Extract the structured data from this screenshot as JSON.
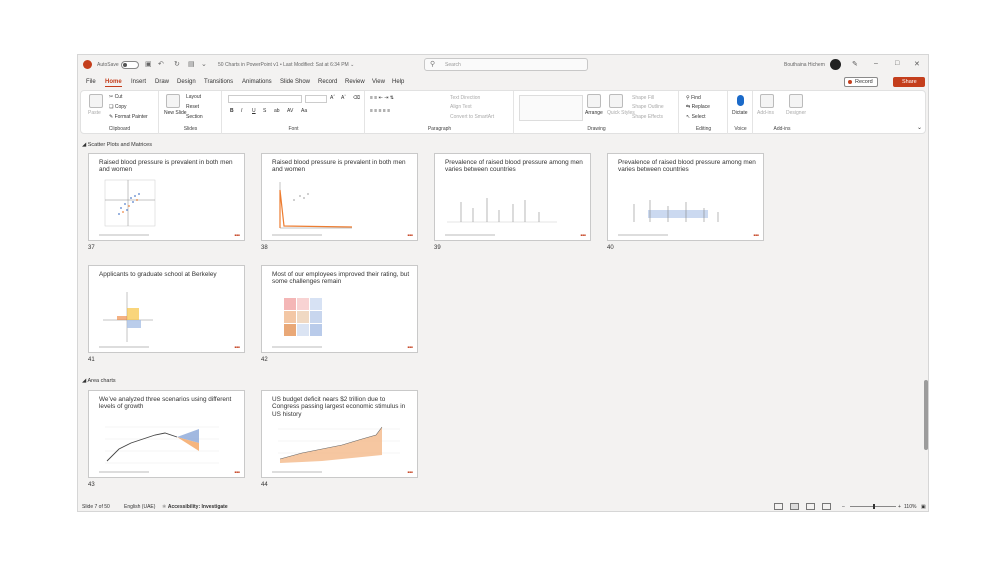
{
  "titlebar": {
    "autosave_label": "AutoSave",
    "doc_title": "50 Charts in PowerPoint v1 • Last Modified: Sat at 6:34 PM ⌄",
    "search_placeholder": "Search",
    "user_name": "Bouthaina Hichem"
  },
  "menu": {
    "tabs": [
      "File",
      "Home",
      "Insert",
      "Draw",
      "Design",
      "Transitions",
      "Animations",
      "Slide Show",
      "Record",
      "Review",
      "View",
      "Help"
    ],
    "active_tab": "Home",
    "record_label": "Record",
    "share_label": "Share"
  },
  "ribbon": {
    "clipboard": {
      "label": "Clipboard",
      "paste": "Paste",
      "cut": "Cut",
      "copy": "Copy",
      "format_painter": "Format Painter"
    },
    "slides": {
      "label": "Slides",
      "new_slide": "New Slide",
      "layout": "Layout",
      "reset": "Reset",
      "section": "Section"
    },
    "font": {
      "label": "Font",
      "buttons": [
        "B",
        "I",
        "U",
        "S",
        "ab",
        "AV",
        "Aa"
      ]
    },
    "paragraph": {
      "label": "Paragraph",
      "text_direction": "Text Direction",
      "align_text": "Align Text",
      "convert": "Convert to SmartArt"
    },
    "drawing": {
      "label": "Drawing",
      "arrange": "Arrange",
      "quick_styles": "Quick Styles",
      "shape_fill": "Shape Fill",
      "shape_outline": "Shape Outline",
      "shape_effects": "Shape Effects"
    },
    "editing": {
      "label": "Editing",
      "find": "Find",
      "replace": "Replace",
      "select": "Select"
    },
    "voice": {
      "label": "Voice",
      "dictate": "Dictate"
    },
    "addins": {
      "label": "Add-ins",
      "addins": "Add-ins",
      "designer": "Designer"
    }
  },
  "sections": [
    {
      "label": "Scatter Plots and Matrices"
    },
    {
      "label": "Area charts"
    }
  ],
  "slides": [
    {
      "num": "37",
      "title": "Raised blood pressure is prevalent in both men and women"
    },
    {
      "num": "38",
      "title": "Raised blood pressure is prevalent in both men and women"
    },
    {
      "num": "39",
      "title": "Prevalence of raised blood pressure among men varies between countries"
    },
    {
      "num": "40",
      "title": "Prevalence of raised blood pressure among men varies between countries"
    },
    {
      "num": "41",
      "title": "Applicants to graduate school at Berkeley"
    },
    {
      "num": "42",
      "title": "Most of our employees improved their rating, but some challenges remain"
    },
    {
      "num": "43",
      "title": "We’ve analyzed three scenarios using different levels of growth"
    },
    {
      "num": "44",
      "title": "US budget deficit nears $2 trillion due to Congress passing largest economic stimulus in US history"
    }
  ],
  "status": {
    "slide_count": "Slide 7 of 50",
    "language": "English (UAE)",
    "accessibility": "Accessibility: Investigate",
    "zoom": "110%"
  },
  "colors": {
    "accent": "#c43e1c",
    "blue": "#4472c4",
    "orange": "#ed7d31"
  }
}
